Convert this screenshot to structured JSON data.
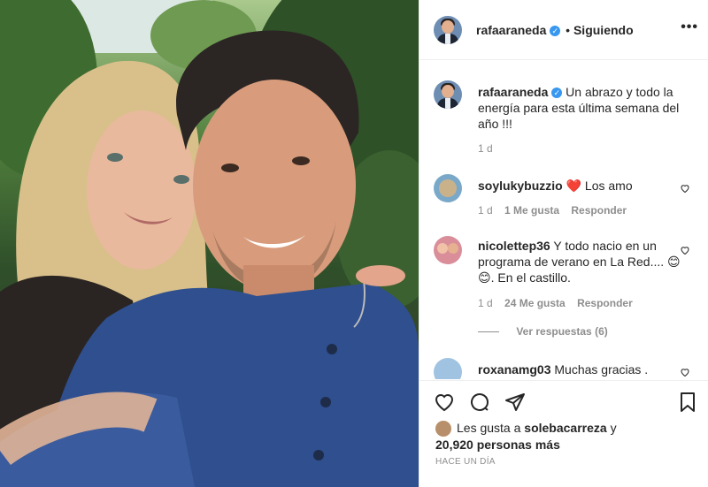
{
  "post": {
    "username": "rafaaraneda",
    "verified_icon": "verified-badge-icon",
    "follow_status": "Siguiendo",
    "separator": "•",
    "caption": "Un abrazo y todo la energía para esta última semana del año !!!",
    "caption_time": "1 d"
  },
  "comments": [
    {
      "username": "soylukybuzzio",
      "text": "Los amo",
      "emoji": "❤️",
      "time": "1 d",
      "likes": "1 Me gusta",
      "reply": "Responder"
    },
    {
      "username": "nicolettep36",
      "text": "Y todo nacio en un programa de verano en La Red.... ",
      "emoji": "😊😊",
      "text_tail": ". En el castillo.",
      "time": "1 d",
      "likes": "24 Me gusta",
      "reply": "Responder",
      "view_replies": "Ver respuestas (6)"
    },
    {
      "username": "roxanamg03",
      "text": "Muchas gracias ."
    }
  ],
  "likes_summary": {
    "prefix": "Les gusta a",
    "user": "solebacarreza",
    "connector": "y",
    "count": "20,920 personas más"
  },
  "timestamp": "HACE UN DÍA",
  "colors": {
    "verified": "#3897f0",
    "like_red": "#ed4956",
    "muted": "#8e8e8e"
  }
}
